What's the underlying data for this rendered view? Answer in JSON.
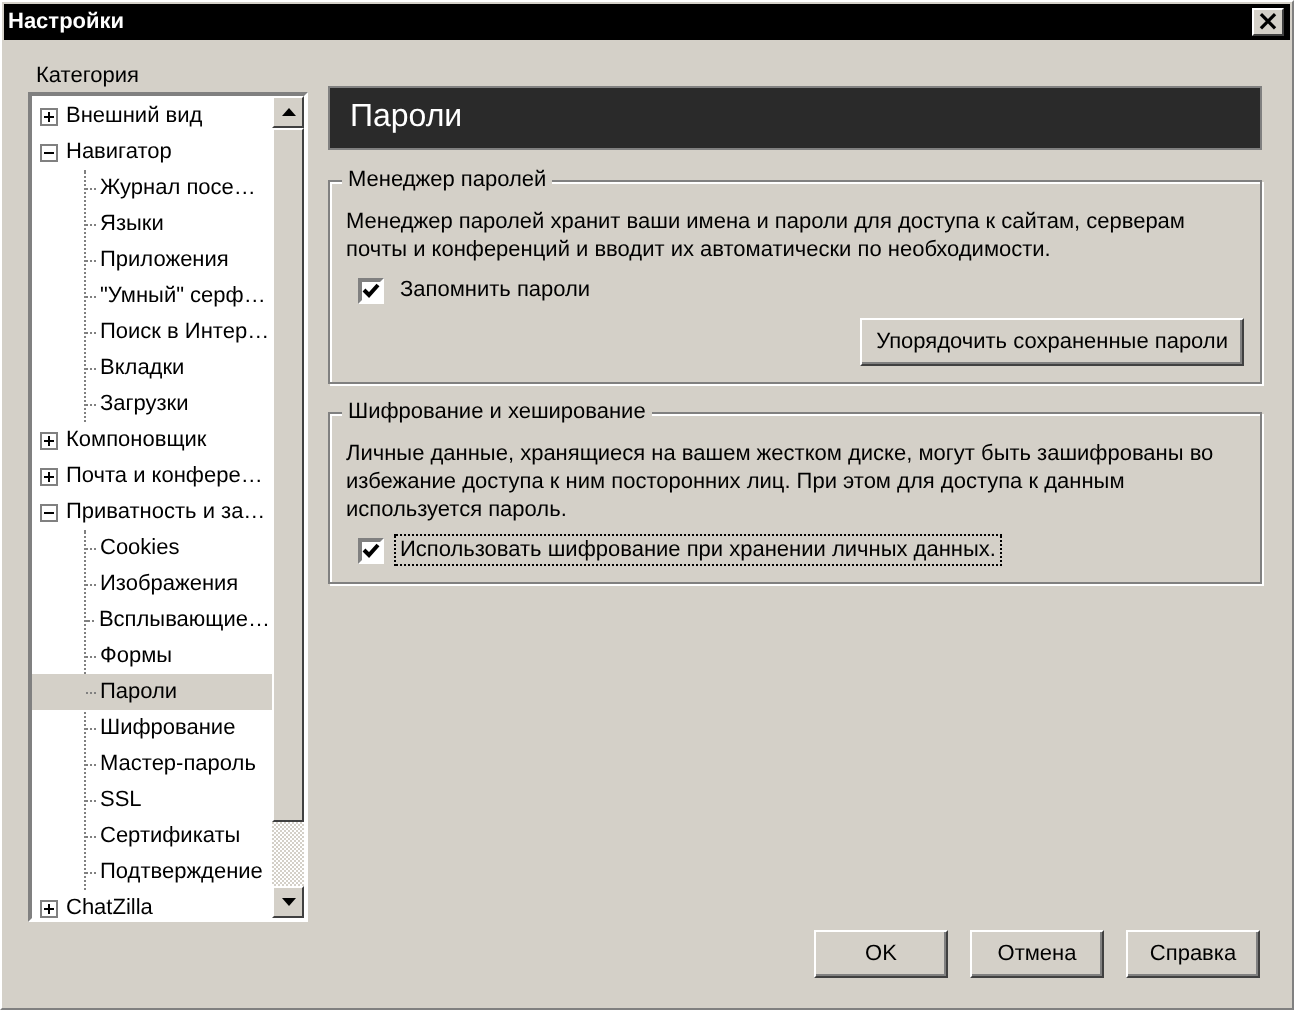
{
  "window": {
    "title": "Настройки",
    "close": "×"
  },
  "sidebar": {
    "label": "Категория",
    "items": [
      {
        "label": "Внешний вид",
        "expanded": false,
        "selected": false
      },
      {
        "label": "Навигатор",
        "expanded": true,
        "selected": false,
        "children": [
          {
            "label": "Журнал посе…",
            "selected": false
          },
          {
            "label": "Языки",
            "selected": false
          },
          {
            "label": "Приложения",
            "selected": false
          },
          {
            "label": "\"Умный\" серф…",
            "selected": false
          },
          {
            "label": "Поиск в Интер…",
            "selected": false
          },
          {
            "label": "Вкладки",
            "selected": false
          },
          {
            "label": "Загрузки",
            "selected": false
          }
        ]
      },
      {
        "label": "Компоновщик",
        "expanded": false,
        "selected": false
      },
      {
        "label": "Почта и конфере…",
        "expanded": false,
        "selected": false
      },
      {
        "label": "Приватность и за…",
        "expanded": true,
        "selected": false,
        "children": [
          {
            "label": "Cookies",
            "selected": false
          },
          {
            "label": "Изображения",
            "selected": false
          },
          {
            "label": "Всплывающие…",
            "selected": false
          },
          {
            "label": "Формы",
            "selected": false
          },
          {
            "label": "Пароли",
            "selected": true
          },
          {
            "label": "Шифрование",
            "selected": false
          },
          {
            "label": "Мастер-пароль",
            "selected": false
          },
          {
            "label": "SSL",
            "selected": false
          },
          {
            "label": "Сертификаты",
            "selected": false
          },
          {
            "label": "Подтверждение",
            "selected": false
          }
        ]
      },
      {
        "label": "ChatZilla",
        "expanded": false,
        "selected": false
      }
    ]
  },
  "panel": {
    "title": "Пароли",
    "groups": [
      {
        "title": "Менеджер паролей",
        "text": "Менеджер паролей хранит ваши имена и пароли для доступа к сайтам, серверам почты и конференций и вводит их автоматически по необходимости.",
        "checkbox": {
          "label": "Запомнить пароли",
          "checked": true,
          "focused": false
        },
        "button": "Упорядочить сохраненные пароли"
      },
      {
        "title": "Шифрование и хеширование",
        "text": "Личные данные, хранящиеся на вашем жестком диске, могут быть зашифрованы во избежание доступа к ним посторонних лиц. При этом для доступа к данным используется пароль.",
        "checkbox": {
          "label": "Использовать шифрование при хранении личных данных.",
          "checked": true,
          "focused": true
        }
      }
    ]
  },
  "buttons": [
    "OK",
    "Отмена",
    "Справка"
  ]
}
